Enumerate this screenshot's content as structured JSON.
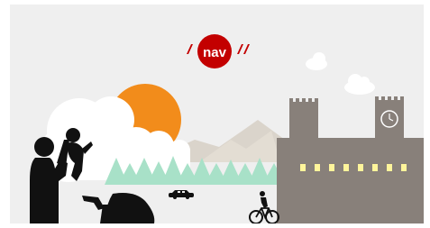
{
  "logo": {
    "text": "nav",
    "brand_color": "#C30000"
  },
  "colors": {
    "background": "#EFEFEF",
    "cloud": "#FFFFFF",
    "sun": "#F28C1B",
    "hills": "#DAD4CB",
    "trees": "#A8E1C8",
    "building": "#88807A",
    "windows": "#FFF59B",
    "figures": "#111111"
  },
  "icons": [
    "nav-logo",
    "sun-icon",
    "cloud-icon",
    "building-icon",
    "clock-icon",
    "car-icon",
    "bicycle-icon",
    "parent-child-icon",
    "stroller-icon"
  ]
}
